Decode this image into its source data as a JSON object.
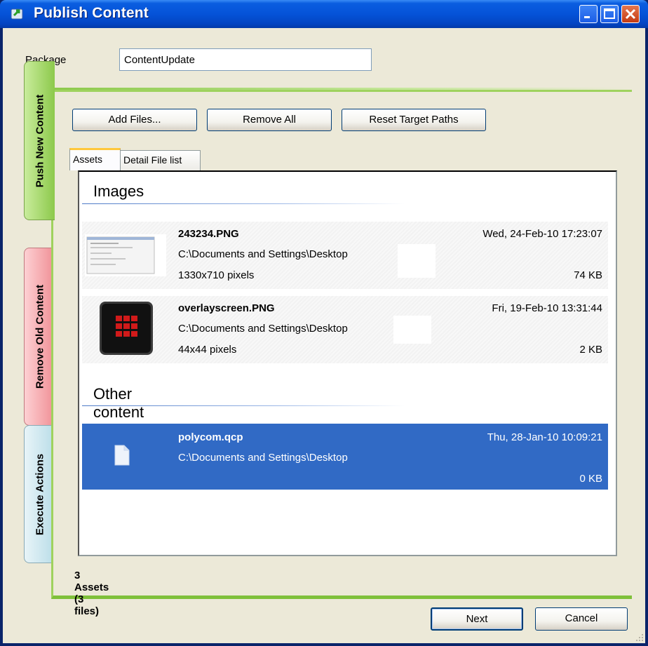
{
  "window": {
    "title": "Publish Content"
  },
  "package": {
    "label": "Package Name",
    "value": "ContentUpdate"
  },
  "side_tabs": [
    "Push New Content",
    "Remove Old Content",
    "Execute Actions"
  ],
  "toolbar": {
    "add_files": "Add Files...",
    "remove_all": "Remove All",
    "reset_paths": "Reset Target Paths"
  },
  "tabs": {
    "assets": "Assets",
    "detail": "Detail File list"
  },
  "groups": {
    "images": "Images",
    "other": "Other content"
  },
  "items": [
    {
      "name": "243234.PNG",
      "path": "C:\\Documents and Settings\\Desktop",
      "dims": "1330x710 pixels",
      "date": "Wed, 24-Feb-10 17:23:07",
      "size": "74 KB"
    },
    {
      "name": "overlayscreen.PNG",
      "path": "C:\\Documents and Settings\\Desktop",
      "dims": "44x44 pixels",
      "date": "Fri, 19-Feb-10 13:31:44",
      "size": "2 KB"
    },
    {
      "name": "polycom.qcp",
      "path": "C:\\Documents and Settings\\Desktop",
      "date": "Thu, 28-Jan-10 10:09:21",
      "size": "0 KB"
    }
  ],
  "status": "3 Assets (3 files)",
  "footer": {
    "next": "Next",
    "cancel": "Cancel"
  },
  "colors": {
    "titlebar": "#0553d8",
    "selection": "#316ac5",
    "push_tab": "#8cc94b",
    "remove_tab": "#f08f95",
    "exec_tab": "#b9dde8"
  },
  "icons": [
    "app-icon",
    "minimize-icon",
    "maximize-icon",
    "close-icon",
    "document-icon",
    "grid-thumbnail-icon"
  ]
}
